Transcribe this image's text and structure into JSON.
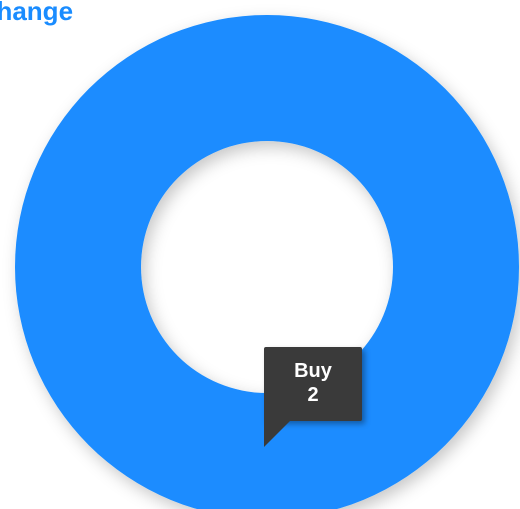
{
  "chart_data": {
    "type": "pie",
    "title": "change",
    "categories": [
      "Buy"
    ],
    "values": [
      2
    ],
    "colors": [
      "#1a8cff"
    ],
    "style": "donut",
    "tooltip": {
      "category": "Buy",
      "value": "2"
    }
  }
}
